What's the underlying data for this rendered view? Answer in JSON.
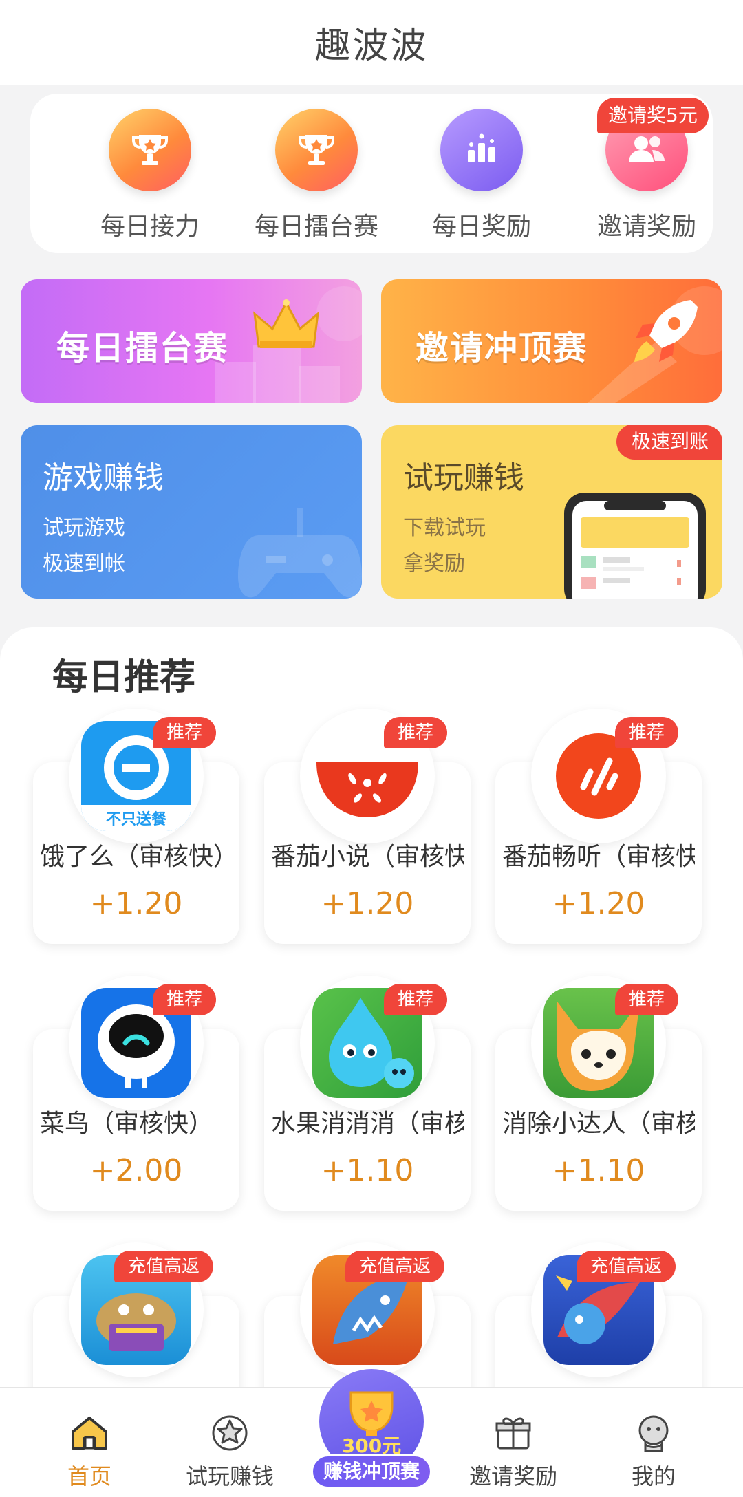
{
  "header": {
    "title": "趣波波"
  },
  "quick_entries": [
    {
      "label": "每日接力",
      "icon": "trophy-icon"
    },
    {
      "label": "每日擂台赛",
      "icon": "trophy-icon"
    },
    {
      "label": "每日奖励",
      "icon": "podium-icon"
    },
    {
      "label": "邀请奖励",
      "icon": "users-icon"
    }
  ],
  "quick_badge": "邀请奖5元",
  "banners": {
    "arena": "每日擂台赛",
    "invite": "邀请冲顶赛"
  },
  "tasks": {
    "game": {
      "title": "游戏赚钱",
      "line1": "试玩游戏",
      "line2": "极速到帐"
    },
    "trial": {
      "title": "试玩赚钱",
      "line1": "下载试玩",
      "line2": "拿奖励",
      "badge": "极速到账"
    }
  },
  "recommend": {
    "title": "每日推荐",
    "apps": [
      {
        "name": "饿了么（审核快）",
        "reward": "+1.20",
        "tag": "推荐",
        "icon": "eleme-icon"
      },
      {
        "name": "番茄小说（审核快）",
        "reward": "+1.20",
        "tag": "推荐",
        "icon": "tomato-novel-icon"
      },
      {
        "name": "番茄畅听（审核快）",
        "reward": "+1.20",
        "tag": "推荐",
        "icon": "tomato-listen-icon"
      },
      {
        "name": "菜鸟（审核快）",
        "reward": "+2.00",
        "tag": "推荐",
        "icon": "cainiao-icon"
      },
      {
        "name": "水果消消消（审核快）",
        "reward": "+1.10",
        "tag": "推荐",
        "icon": "water-drop-game-icon"
      },
      {
        "name": "消除小达人（审核快）",
        "reward": "+1.10",
        "tag": "推荐",
        "icon": "fox-game-icon"
      },
      {
        "name": "",
        "reward": "",
        "tag": "充值高返",
        "icon": "fish-game-icon"
      },
      {
        "name": "",
        "reward": "",
        "tag": "充值高返",
        "icon": "shark-game-icon"
      },
      {
        "name": "",
        "reward": "",
        "tag": "充值高返",
        "icon": "dragon-game-icon"
      }
    ]
  },
  "bottom_nav": [
    {
      "label": "首页",
      "icon": "home-icon",
      "active": true
    },
    {
      "label": "试玩赚钱",
      "icon": "star-icon",
      "active": false
    },
    {
      "label": "邀请奖励",
      "icon": "gift-icon",
      "active": false
    },
    {
      "label": "我的",
      "icon": "profile-icon",
      "active": false
    }
  ],
  "center_button": {
    "label": "赚钱冲顶赛",
    "amount": "300元"
  },
  "colors": {
    "accent": "#e08a1e",
    "badge_red": "#f0453a",
    "nav_active": "#e08a1e"
  }
}
